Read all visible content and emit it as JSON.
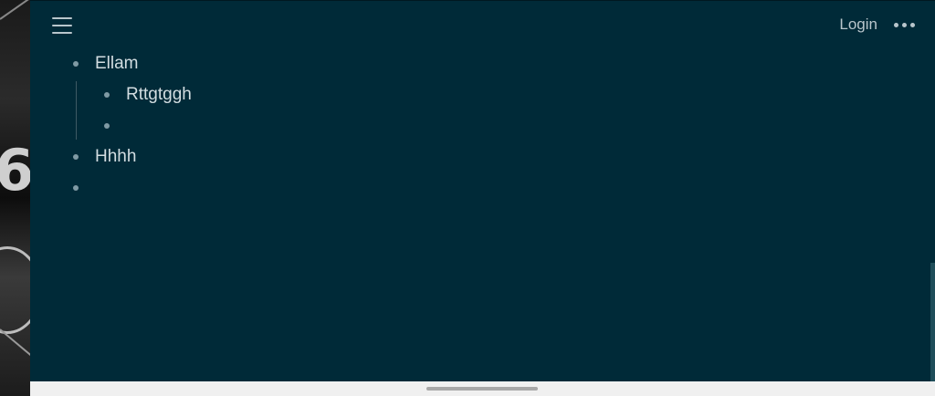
{
  "header": {
    "login_label": "Login",
    "menu_icon": "hamburger-menu-icon",
    "more_icon": "more-horizontal-icon"
  },
  "outline": {
    "items": [
      {
        "text": "Ellam",
        "children": [
          {
            "text": "Rttgtggh"
          },
          {
            "text": ""
          }
        ]
      },
      {
        "text": "Hhhh"
      },
      {
        "text": ""
      }
    ]
  },
  "colors": {
    "background": "#002a38",
    "text": "#d3dde1",
    "bullet": "#7f9aa4"
  }
}
